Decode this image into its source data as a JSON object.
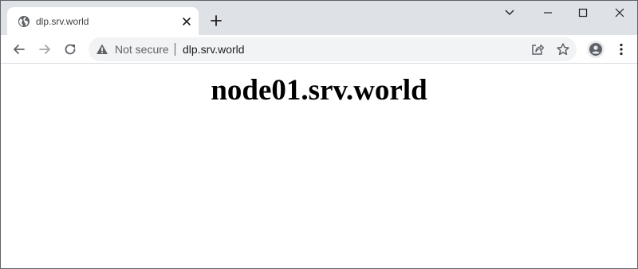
{
  "tab": {
    "title": "dlp.srv.world",
    "favicon": "globe-icon"
  },
  "toolbar": {
    "security_label": "Not secure",
    "url": "dlp.srv.world"
  },
  "content": {
    "heading": "node01.srv.world"
  },
  "colors": {
    "tabstrip_bg": "#dee1e6",
    "omnibox_bg": "#f1f3f4",
    "icon": "#5f6368"
  }
}
